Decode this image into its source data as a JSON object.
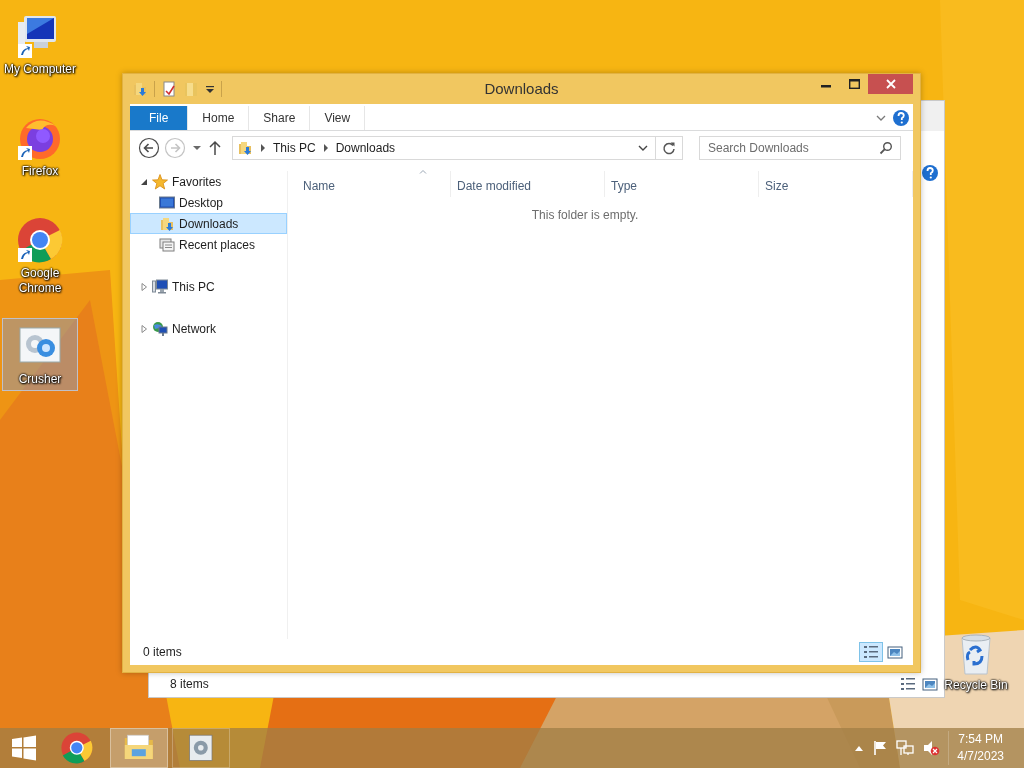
{
  "desktop_icons": [
    {
      "kind": "computer",
      "label": "My Computer",
      "selected": false
    },
    {
      "kind": "firefox",
      "label": "Firefox",
      "selected": false
    },
    {
      "kind": "chrome",
      "label": "Google Chrome",
      "selected": false
    },
    {
      "kind": "crusher",
      "label": "Crusher",
      "selected": true
    }
  ],
  "recycle_bin": {
    "label": "Recycle Bin"
  },
  "back_window": {
    "status": "8 items"
  },
  "window": {
    "title": "Downloads",
    "ribbon_tabs": [
      {
        "label": "File",
        "kind": "file"
      },
      {
        "label": "Home",
        "kind": "tab"
      },
      {
        "label": "Share",
        "kind": "tab"
      },
      {
        "label": "View",
        "kind": "tab"
      }
    ],
    "nav_buttons": [
      {
        "kind": "back",
        "disabled": false
      },
      {
        "kind": "forward",
        "disabled": true
      }
    ],
    "breadcrumb": [
      "This PC",
      "Downloads"
    ],
    "search": {
      "placeholder": "Search Downloads"
    },
    "nav_tree": [
      {
        "kind": "favorites",
        "label": "Favorites",
        "expanded": true,
        "selected": false,
        "children": [
          {
            "kind": "desktop",
            "label": "Desktop",
            "selected": false
          },
          {
            "kind": "downloads",
            "label": "Downloads",
            "selected": true
          },
          {
            "kind": "recent",
            "label": "Recent places",
            "selected": false
          }
        ]
      },
      {
        "kind": "pc",
        "label": "This PC",
        "expanded": false,
        "selected": false
      },
      {
        "kind": "network",
        "label": "Network",
        "expanded": false,
        "selected": false
      }
    ],
    "columns": [
      {
        "label": "Name",
        "sorted": true
      },
      {
        "label": "Date modified",
        "sorted": false
      },
      {
        "label": "Type",
        "sorted": false
      },
      {
        "label": "Size",
        "sorted": false
      }
    ],
    "empty_message": "This folder is empty.",
    "status": "0 items",
    "views": [
      {
        "kind": "details",
        "selected": true
      },
      {
        "kind": "large-icons",
        "selected": false
      }
    ]
  },
  "taskbar": {
    "apps": [
      {
        "kind": "chrome",
        "selected": false
      },
      {
        "kind": "explorer",
        "selected": true
      },
      {
        "kind": "crusher",
        "selected": false
      }
    ],
    "time": "7:54 PM",
    "date": "4/7/2023"
  }
}
